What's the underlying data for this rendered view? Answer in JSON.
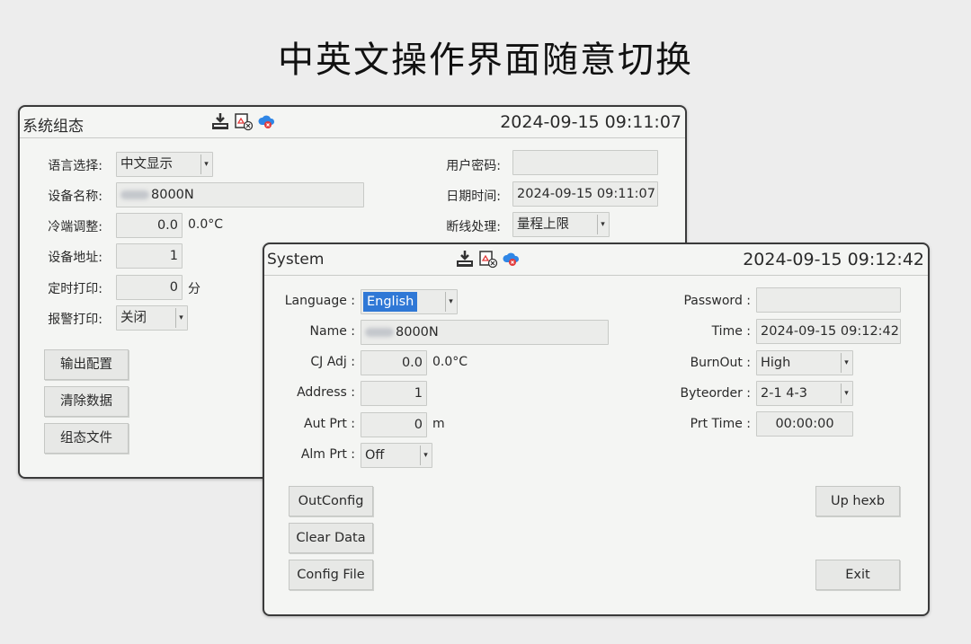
{
  "headline": "中英文操作界面随意切换",
  "zh": {
    "title": "系统组态",
    "datetime": "2024-09-15 09:11:07",
    "labels": {
      "language": "语言选择:",
      "name": "设备名称:",
      "cj": "冷端调整:",
      "address": "设备地址:",
      "timer": "定时打印:",
      "alarm": "报警打印:",
      "password": "用户密码:",
      "time": "日期时间:",
      "burnout": "断线处理:"
    },
    "values": {
      "language": "中文显示",
      "name": "8000N",
      "cj": "0.0",
      "cj_unit": "0.0°C",
      "address": "1",
      "timer": "0",
      "timer_unit": "分",
      "alarm": "关闭",
      "password": "",
      "time": "2024-09-15 09:11:07",
      "burnout": "量程上限"
    },
    "buttons": {
      "out_config": "输出配置",
      "clear_data": "清除数据",
      "config_file": "组态文件"
    }
  },
  "en": {
    "title": "System",
    "datetime": "2024-09-15 09:12:42",
    "labels": {
      "language": "Language :",
      "name": "Name :",
      "cj": "CJ Adj :",
      "address": "Address :",
      "aut_prt": "Aut Prt :",
      "alm_prt": "Alm Prt :",
      "password": "Password :",
      "time": "Time :",
      "burnout": "BurnOut :",
      "byteorder": "Byteorder :",
      "prt_time": "Prt Time :"
    },
    "values": {
      "language": "English",
      "name": "8000N",
      "cj": "0.0",
      "cj_unit": "0.0°C",
      "address": "1",
      "aut_prt": "0",
      "aut_prt_unit": "m",
      "alm_prt": "Off",
      "password": "",
      "time": "2024-09-15 09:12:42",
      "burnout": "High",
      "byteorder": "2-1 4-3",
      "prt_time": "00:00:00"
    },
    "buttons": {
      "out_config": "OutConfig",
      "clear_data": "Clear Data",
      "config_file": "Config File",
      "up_hexb": "Up hexb",
      "exit": "Exit"
    }
  },
  "icons": [
    "download-tray-icon",
    "alarm-doc-icon",
    "cloud-error-icon"
  ],
  "colors": {
    "selection": "#2f78d6",
    "cloud": "#2f86e6",
    "error": "#e23b3b"
  }
}
